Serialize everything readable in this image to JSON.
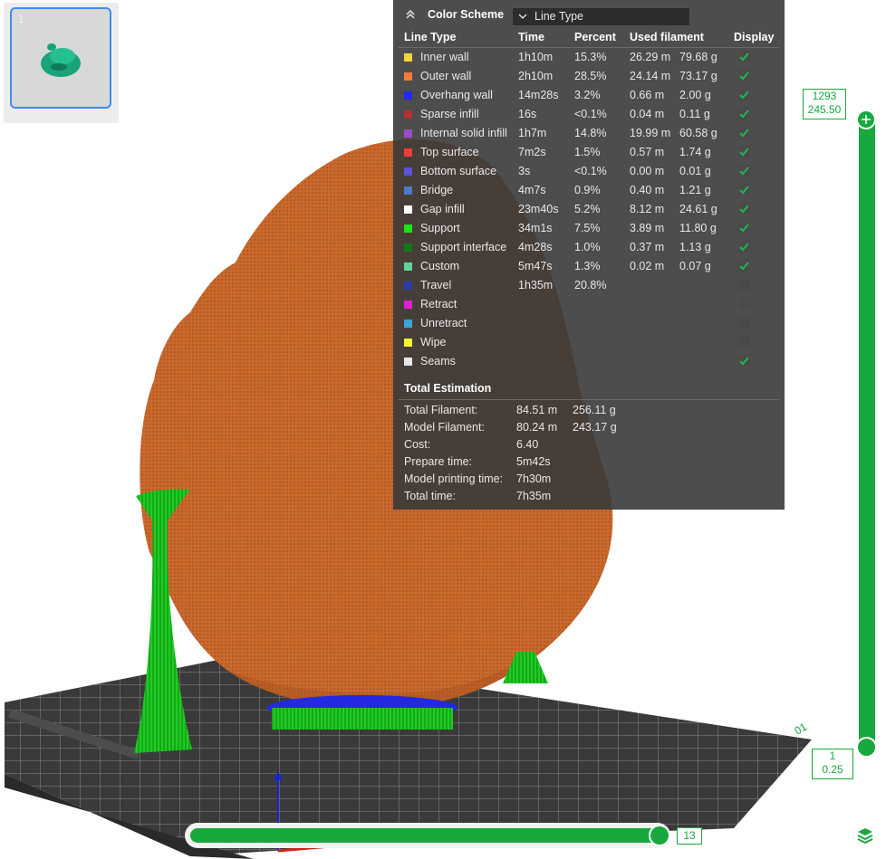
{
  "thumbnail": {
    "plate_number": "1"
  },
  "panel": {
    "title": "Color Scheme",
    "scheme_value": "Line Type",
    "headers": {
      "line_type": "Line Type",
      "time": "Time",
      "percent": "Percent",
      "used_filament": "Used filament",
      "display": "Display"
    },
    "rows": [
      {
        "name": "Inner wall",
        "color": "#f3d53a",
        "time": "1h10m",
        "percent": "15.3%",
        "meters": "26.29 m",
        "grams": "79.68 g",
        "checked": true
      },
      {
        "name": "Outer wall",
        "color": "#f07c3c",
        "time": "2h10m",
        "percent": "28.5%",
        "meters": "24.14 m",
        "grams": "73.17 g",
        "checked": true
      },
      {
        "name": "Overhang wall",
        "color": "#2129f0",
        "time": "14m28s",
        "percent": "3.2%",
        "meters": "0.66 m",
        "grams": "2.00 g",
        "checked": true
      },
      {
        "name": "Sparse infill",
        "color": "#b03030",
        "time": "16s",
        "percent": "<0.1%",
        "meters": "0.04 m",
        "grams": "0.11 g",
        "checked": true
      },
      {
        "name": "Internal solid infill",
        "color": "#9a4fc7",
        "time": "1h7m",
        "percent": "14.8%",
        "meters": "19.99 m",
        "grams": "60.58 g",
        "checked": true
      },
      {
        "name": "Top surface",
        "color": "#f03c3c",
        "time": "7m2s",
        "percent": "1.5%",
        "meters": "0.57 m",
        "grams": "1.74 g",
        "checked": true
      },
      {
        "name": "Bottom surface",
        "color": "#5a52d8",
        "time": "3s",
        "percent": "<0.1%",
        "meters": "0.00 m",
        "grams": "0.01 g",
        "checked": true
      },
      {
        "name": "Bridge",
        "color": "#4f7ac7",
        "time": "4m7s",
        "percent": "0.9%",
        "meters": "0.40 m",
        "grams": "1.21 g",
        "checked": true
      },
      {
        "name": "Gap infill",
        "color": "#ffffff",
        "time": "23m40s",
        "percent": "5.2%",
        "meters": "8.12 m",
        "grams": "24.61 g",
        "checked": true
      },
      {
        "name": "Support",
        "color": "#19e619",
        "time": "34m1s",
        "percent": "7.5%",
        "meters": "3.89 m",
        "grams": "11.80 g",
        "checked": true
      },
      {
        "name": "Support interface",
        "color": "#127a12",
        "time": "4m28s",
        "percent": "1.0%",
        "meters": "0.37 m",
        "grams": "1.13 g",
        "checked": true
      },
      {
        "name": "Custom",
        "color": "#5fd19a",
        "time": "5m47s",
        "percent": "1.3%",
        "meters": "0.02 m",
        "grams": "0.07 g",
        "checked": true
      },
      {
        "name": "Travel",
        "color": "#2b3fa8",
        "time": "1h35m",
        "percent": "20.8%",
        "meters": "",
        "grams": "",
        "checked": false
      },
      {
        "name": "Retract",
        "color": "#e01ed8",
        "time": "",
        "percent": "",
        "meters": "",
        "grams": "",
        "checked": false
      },
      {
        "name": "Unretract",
        "color": "#3aa6d8",
        "time": "",
        "percent": "",
        "meters": "",
        "grams": "",
        "checked": false
      },
      {
        "name": "Wipe",
        "color": "#f5f03a",
        "time": "",
        "percent": "",
        "meters": "",
        "grams": "",
        "checked": false
      },
      {
        "name": "Seams",
        "color": "#e6e6e6",
        "time": "",
        "percent": "",
        "meters": "",
        "grams": "",
        "checked": true
      }
    ],
    "total_title": "Total Estimation",
    "totals": [
      {
        "label": "Total Filament:",
        "v1": "84.51 m",
        "v2": "256.11 g"
      },
      {
        "label": "Model Filament:",
        "v1": "80.24 m",
        "v2": "243.17 g"
      },
      {
        "label": "Cost:",
        "v1": "6.40",
        "v2": ""
      },
      {
        "label": "Prepare time:",
        "v1": "5m42s",
        "v2": ""
      },
      {
        "label": "Model printing time:",
        "v1": "7h30m",
        "v2": ""
      },
      {
        "label": "Total time:",
        "v1": "7h35m",
        "v2": ""
      }
    ]
  },
  "layer_slider": {
    "top_layer": "1293",
    "top_height": "245.50",
    "bottom_layer": "1",
    "bottom_height": "0.25"
  },
  "move_slider": {
    "value": "13"
  },
  "colors": {
    "accent": "#18a83d",
    "model_orange": "#c8682e",
    "support_green": "#19c41f"
  }
}
